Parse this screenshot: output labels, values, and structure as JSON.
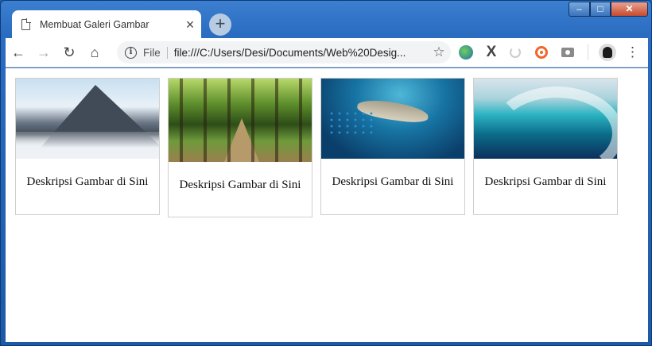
{
  "browser": {
    "tab_title": "Membuat Galeri Gambar",
    "tab_close": "×",
    "new_tab": "+",
    "address_scheme": "File",
    "address_url": "file:///C:/Users/Desi/Documents/Web%20Desig...",
    "window_controls": {
      "minimize": "–",
      "maximize": "□",
      "close": "✕"
    }
  },
  "gallery": {
    "items": [
      {
        "image": "snowy-mountain-peaks",
        "description": "Deskripsi Gambar di Sini"
      },
      {
        "image": "forest-path",
        "description": "Deskripsi Gambar di Sini"
      },
      {
        "image": "shark-and-fish-underwater",
        "description": "Deskripsi Gambar di Sini"
      },
      {
        "image": "ocean-wave",
        "description": "Deskripsi Gambar di Sini"
      }
    ]
  }
}
